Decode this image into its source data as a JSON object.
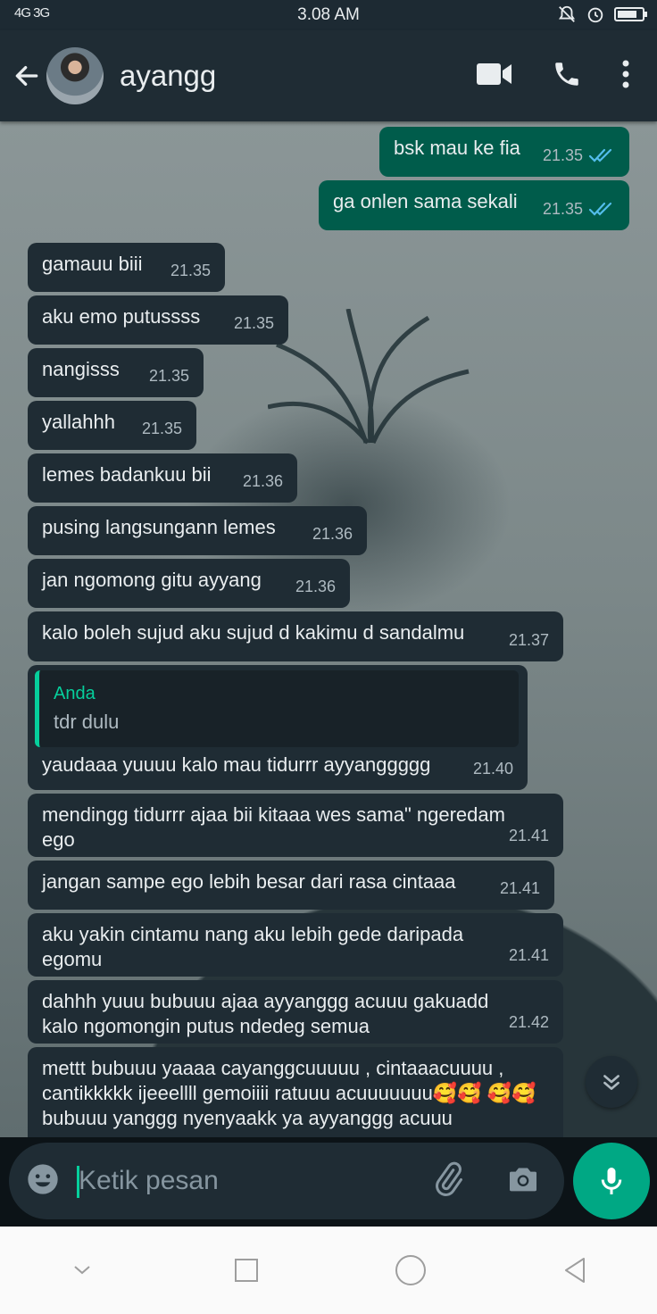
{
  "status_bar": {
    "signal": "4G 3G",
    "time": "3.08 AM"
  },
  "header": {
    "contact_name": "ayangg"
  },
  "messages": [
    {
      "dir": "out",
      "text": "bsk mau ke fia",
      "time": "21.35",
      "read": true
    },
    {
      "dir": "out",
      "text": "ga onlen sama sekali",
      "time": "21.35",
      "read": true
    },
    {
      "dir": "in",
      "text": "gamauu biii",
      "time": "21.35"
    },
    {
      "dir": "in",
      "text": "aku emo putussss",
      "time": "21.35"
    },
    {
      "dir": "in",
      "text": "nangisss",
      "time": "21.35"
    },
    {
      "dir": "in",
      "text": "yallahhh",
      "time": "21.35"
    },
    {
      "dir": "in",
      "text": "lemes badankuu bii",
      "time": "21.36"
    },
    {
      "dir": "in",
      "text": "pusing langsungann lemes",
      "time": "21.36"
    },
    {
      "dir": "in",
      "text": "jan ngomong gitu ayyang",
      "time": "21.36"
    },
    {
      "dir": "in",
      "text": "kalo boleh sujud aku sujud d kakimu d sandalmu",
      "time": "21.37"
    },
    {
      "dir": "in",
      "quote_author": "Anda",
      "quote_text": "tdr dulu",
      "text": "yaudaaa yuuuu kalo mau tidurrr ayyanggggg",
      "time": "21.40"
    },
    {
      "dir": "in",
      "text": "mendingg tidurrr ajaa bii kitaaa wes sama\" ngeredam ego",
      "time": "21.41"
    },
    {
      "dir": "in",
      "text": "jangan sampe ego lebih besar dari rasa cintaaa",
      "time": "21.41"
    },
    {
      "dir": "in",
      "text": "aku yakin cintamu nang aku lebih gede daripada egomu",
      "time": "21.41"
    },
    {
      "dir": "in",
      "text": "dahhh yuuu bubuuu ajaa ayyanggg acuuu gakuadd kalo ngomongin putus ndedeg semua",
      "time": "21.42"
    },
    {
      "dir": "in",
      "text": "mettt bubuuu yaaaa cayanggcuuuuu , cintaaacuuuu , cantikkkkk ijeeellll gemoiiii ratuuu acuuuuuuu🥰🥰 🥰🥰 bubuuu yanggg nyenyaakk ya ayyanggg acuuu",
      "time": ""
    }
  ],
  "input": {
    "placeholder": "Ketik pesan"
  },
  "icons": {
    "back": "arrow-left-icon",
    "video": "video-call-icon",
    "call": "phone-icon",
    "menu": "more-vertical-icon",
    "emoji": "emoji-icon",
    "attach": "paperclip-icon",
    "camera": "camera-icon",
    "mic": "microphone-icon",
    "scroll": "double-chevron-down-icon"
  },
  "colors": {
    "header_bg": "#1f2c34",
    "incoming_bubble": "#1f2c34",
    "outgoing_bubble": "#005c4b",
    "accent": "#00a884",
    "read_tick": "#53bdeb"
  }
}
